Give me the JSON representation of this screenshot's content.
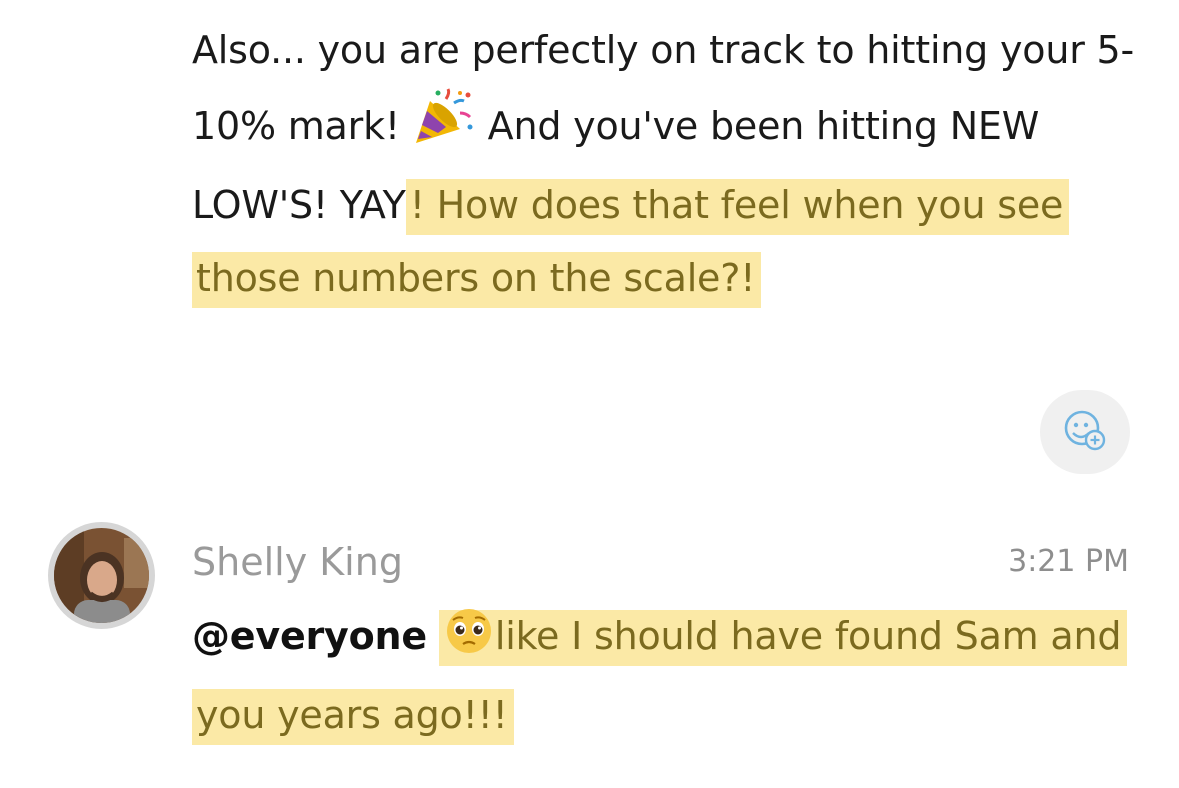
{
  "message1": {
    "text_a": "Also... you are perfectly on track to hitting your 5-10% mark! ",
    "emoji": "party-popper",
    "text_b": " And you've been hitting NEW LOW'S! YAY",
    "highlighted": "! How does that feel when you see those numbers on the scale?! "
  },
  "reaction_button": {
    "icon": "add-reaction-icon"
  },
  "message2": {
    "sender": "Shelly King",
    "time": "3:21 PM",
    "mention": "@everyone",
    "emoji": "pleading-face",
    "highlighted": "like I should have found Sam and you years ago!!! "
  },
  "colors": {
    "highlight_bg": "#fbe9a6",
    "highlight_text": "#7b6a1f",
    "sender": "#9a9a9a",
    "reaction_bg": "#f0f0f0",
    "reaction_icon": "#6fb3e0"
  }
}
